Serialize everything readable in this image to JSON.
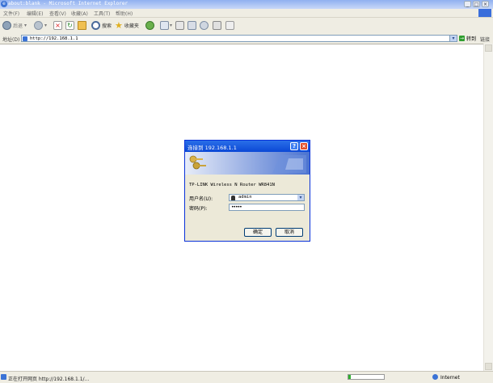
{
  "window": {
    "title": "about:blank - Microsoft Internet Explorer"
  },
  "menu": {
    "items": [
      "文件(F)",
      "编辑(E)",
      "查看(V)",
      "收藏(A)",
      "工具(T)",
      "帮助(H)"
    ]
  },
  "toolbar": {
    "back": "后退",
    "search": "搜索",
    "favorites": "收藏夹"
  },
  "address": {
    "label": "地址(D)",
    "url": "http://192.168.1.1",
    "go": "转到",
    "links": "链接"
  },
  "dialog": {
    "title": "连接到 192.168.1.1",
    "realm": "TP-LINK Wireless N Router WR841N",
    "username_label": "用户名(U):",
    "username_value": "admin",
    "password_label": "密码(P):",
    "password_value": "•••••",
    "ok": "确定",
    "cancel": "取消"
  },
  "status": {
    "text": "正在打开网页 http://192.168.1.1/...",
    "zone": "Internet"
  },
  "colors": {
    "titlebar": "#8fb0f0",
    "dialog_title": "#0b48d6",
    "close": "#e0502a",
    "chrome": "#efede3"
  }
}
